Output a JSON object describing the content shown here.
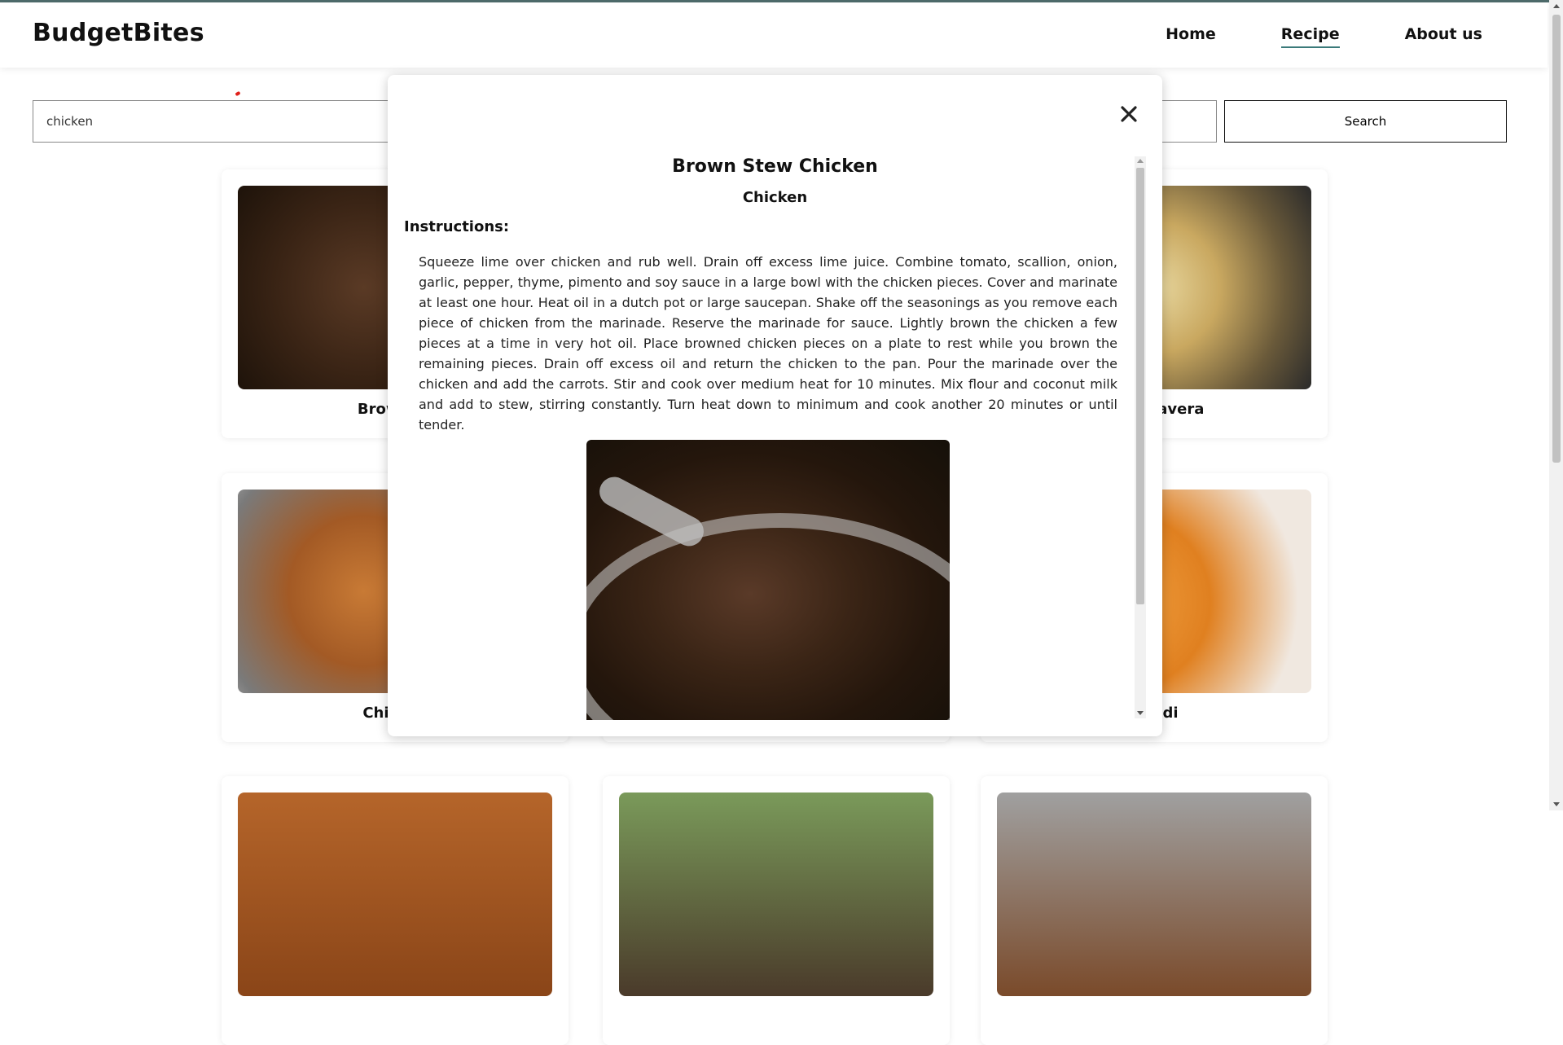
{
  "header": {
    "brand": "BudgetBites",
    "nav": [
      {
        "label": "Home",
        "active": false
      },
      {
        "label": "Recipe",
        "active": true
      },
      {
        "label": "About us",
        "active": false
      }
    ]
  },
  "search": {
    "value": "chicken",
    "button_label": "Search"
  },
  "cards": [
    {
      "name": "Brown St"
    },
    {
      "name": "o Primavera"
    },
    {
      "name": "Chicken"
    },
    {
      "name": "Handi"
    }
  ],
  "modal": {
    "title": "Brown Stew Chicken",
    "category": "Chicken",
    "instructions_heading": "Instructions:",
    "instructions": "Squeeze lime over chicken and rub well. Drain off excess lime juice. Combine tomato, scallion, onion, garlic, pepper, thyme, pimento and soy sauce in a large bowl with the chicken pieces. Cover and marinate at least one hour. Heat oil in a dutch pot or large saucepan. Shake off the seasonings as you remove each piece of chicken from the marinade. Reserve the marinade for sauce. Lightly brown the chicken a few pieces at a time in very hot oil. Place browned chicken pieces on a plate to rest while you brown the remaining pieces. Drain off excess oil and return the chicken to the pan. Pour the marinade over the chicken and add the carrots. Stir and cook over medium heat for 10 minutes. Mix flour and coconut milk and add to stew, stirring constantly. Turn heat down to minimum and cook another 20 minutes or until tender."
  },
  "colors": {
    "nav_active_underline": "#3a7a7a",
    "top_accent": "#4e6b6b"
  },
  "icons": {
    "close": "close-icon"
  }
}
